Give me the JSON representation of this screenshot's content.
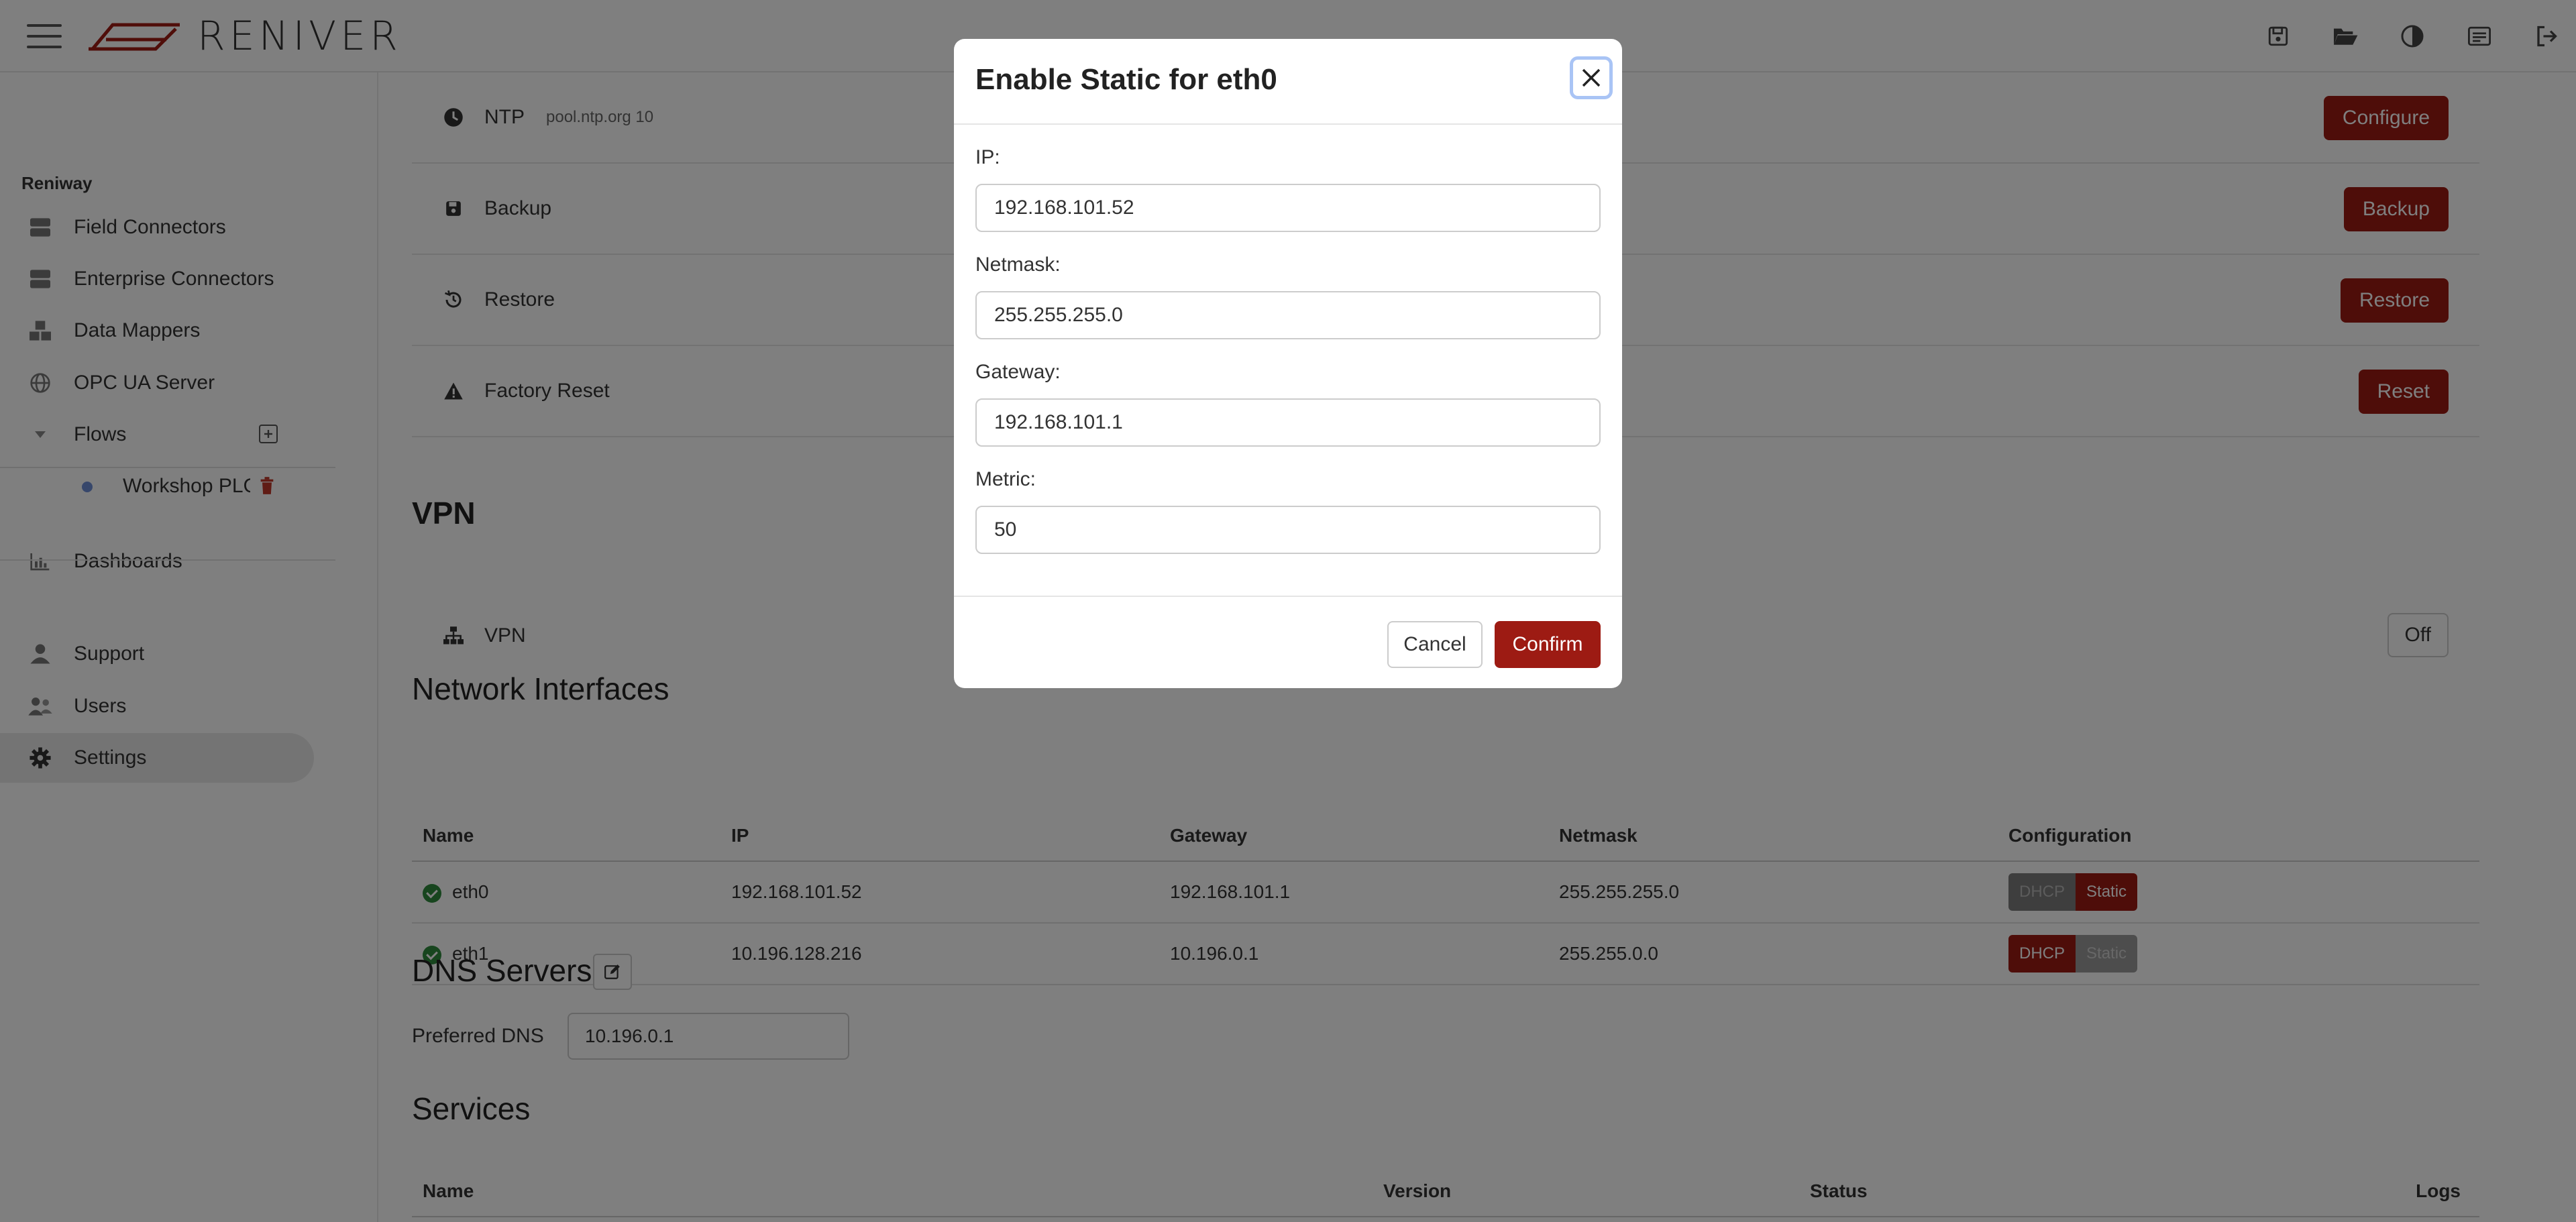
{
  "header": {
    "logo_text": "RENIVER",
    "icons": [
      "save-icon",
      "folder-open-icon",
      "contrast-icon",
      "notes-icon",
      "logout-icon"
    ]
  },
  "sidebar": {
    "group_label": "Reniway",
    "items": [
      {
        "label": "Field Connectors",
        "icon": "server-icon"
      },
      {
        "label": "Enterprise Connectors",
        "icon": "server-icon"
      },
      {
        "label": "Data Mappers",
        "icon": "cubes-icon"
      },
      {
        "label": "OPC UA Server",
        "icon": "globe-icon"
      },
      {
        "label": "Flows",
        "icon": "caret-down-icon"
      },
      {
        "label": "Workshop PLC",
        "icon": "dot-icon"
      },
      {
        "label": "Dashboards",
        "icon": "chart-icon"
      },
      {
        "label": "Support",
        "icon": "support-icon"
      },
      {
        "label": "Users",
        "icon": "users-icon"
      },
      {
        "label": "Settings",
        "icon": "gear-icon"
      }
    ]
  },
  "settings": {
    "ntp": {
      "label": "NTP",
      "value": "pool.ntp.org 10",
      "button": "Configure"
    },
    "backup": {
      "label": "Backup",
      "button": "Backup"
    },
    "restore": {
      "label": "Restore",
      "button": "Restore"
    },
    "factory_reset": {
      "label": "Factory Reset",
      "button": "Reset"
    }
  },
  "vpn": {
    "title": "VPN",
    "label": "VPN",
    "button": "Off"
  },
  "network": {
    "title": "Network Interfaces",
    "columns": [
      "Name",
      "IP",
      "Gateway",
      "Netmask",
      "Configuration"
    ],
    "rows": [
      {
        "name": "eth0",
        "ip": "192.168.101.52",
        "gateway": "192.168.101.1",
        "netmask": "255.255.255.0",
        "dhcp": "DHCP",
        "static": "Static",
        "active": "Static"
      },
      {
        "name": "eth1",
        "ip": "10.196.128.216",
        "gateway": "10.196.0.1",
        "netmask": "255.255.0.0",
        "dhcp": "DHCP",
        "static": "Static",
        "active": "DHCP"
      }
    ]
  },
  "dns": {
    "title": "DNS Servers",
    "preferred_label": "Preferred DNS",
    "preferred_value": "10.196.0.1"
  },
  "services": {
    "title": "Services",
    "columns": [
      "Name",
      "Version",
      "Status",
      "Logs"
    ]
  },
  "modal": {
    "title": "Enable Static for eth0",
    "ip_label": "IP:",
    "ip_value": "192.168.101.52",
    "netmask_label": "Netmask:",
    "netmask_value": "255.255.255.0",
    "gateway_label": "Gateway:",
    "gateway_value": "192.168.101.1",
    "metric_label": "Metric:",
    "metric_value": "50",
    "cancel": "Cancel",
    "confirm": "Confirm"
  },
  "colors": {
    "accent": "#9d1b13",
    "overlay": "rgba(0,0,0,0.5)",
    "success": "#2e8b3d"
  }
}
